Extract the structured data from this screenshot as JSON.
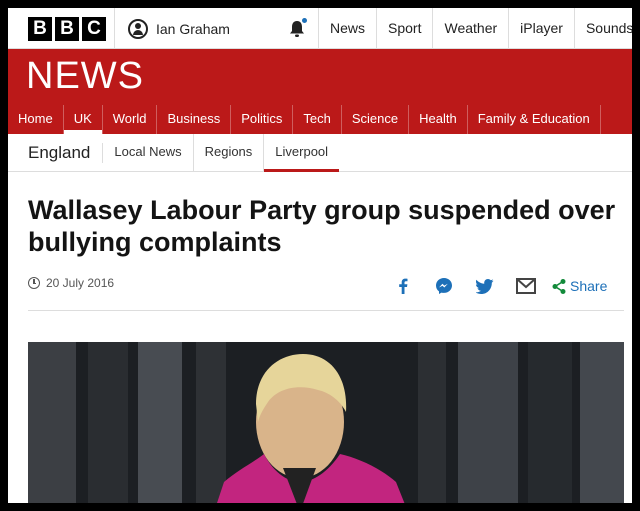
{
  "brand": {
    "letters": [
      "B",
      "B",
      "C"
    ]
  },
  "account": {
    "name": "Ian Graham"
  },
  "top_nav": [
    "News",
    "Sport",
    "Weather",
    "iPlayer",
    "Sounds"
  ],
  "section_title": "NEWS",
  "news_nav": [
    "Home",
    "UK",
    "World",
    "Business",
    "Politics",
    "Tech",
    "Science",
    "Health",
    "Family & Education"
  ],
  "news_nav_active": "UK",
  "sub_nav": {
    "section": "England",
    "items": [
      "Local News",
      "Regions",
      "Liverpool"
    ],
    "active": "Liverpool"
  },
  "article": {
    "headline": "Wallasey Labour Party group suspended over bullying complaints",
    "date": "20 July 2016"
  },
  "share": {
    "icons": [
      "facebook-icon",
      "messenger-icon",
      "twitter-icon",
      "email-icon"
    ],
    "label": "Share"
  },
  "colors": {
    "brand_red": "#bb1919",
    "link_blue": "#1d70b8",
    "logo_black": "#000000"
  }
}
